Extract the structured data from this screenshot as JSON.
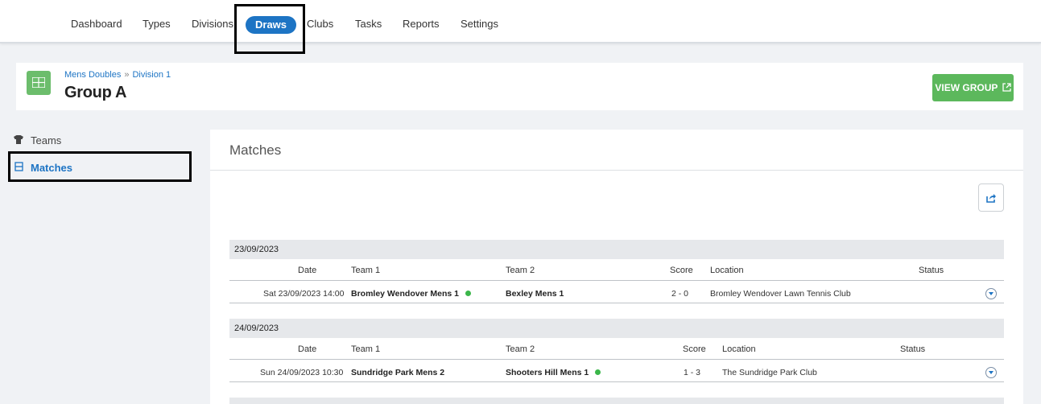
{
  "nav": {
    "items": [
      {
        "label": "Dashboard"
      },
      {
        "label": "Types"
      },
      {
        "label": "Divisions"
      },
      {
        "label": "Draws"
      },
      {
        "label": "Clubs"
      },
      {
        "label": "Tasks"
      },
      {
        "label": "Reports"
      },
      {
        "label": "Settings"
      }
    ],
    "active": "Draws"
  },
  "header": {
    "breadcrumb": [
      "Mens Doubles",
      "»",
      "Division 1"
    ],
    "title": "Group A",
    "view_button": "VIEW GROUP"
  },
  "sidebar": {
    "items": [
      {
        "label": "Teams",
        "icon": "shirt-icon"
      },
      {
        "label": "Matches",
        "icon": "matches-icon"
      }
    ],
    "active": "Matches"
  },
  "matches": {
    "title": "Matches",
    "headers": {
      "date": "Date",
      "team1": "Team 1",
      "team2": "Team 2",
      "score": "Score",
      "location": "Location",
      "status": "Status"
    },
    "groups": [
      {
        "date": "23/09/2023",
        "rows": [
          {
            "date": "Sat 23/09/2023 14:00",
            "team1": "Bromley Wendover Mens 1",
            "team2": "Bexley Mens 1",
            "score": "2 - 0",
            "location": "Bromley Wendover Lawn Tennis Club",
            "winner": "team1"
          }
        ]
      },
      {
        "date": "24/09/2023",
        "rows": [
          {
            "date": "Sun 24/09/2023 10:30",
            "team1": "Sundridge Park Mens 2",
            "team2": "Shooters Hill Mens 1",
            "score": "1 - 3",
            "location": "The Sundridge Park Club",
            "winner": "team2"
          }
        ]
      }
    ]
  },
  "colors": {
    "accent": "#1d74c4",
    "success": "#5cb85c",
    "winner_dot": "#3bb64a"
  }
}
